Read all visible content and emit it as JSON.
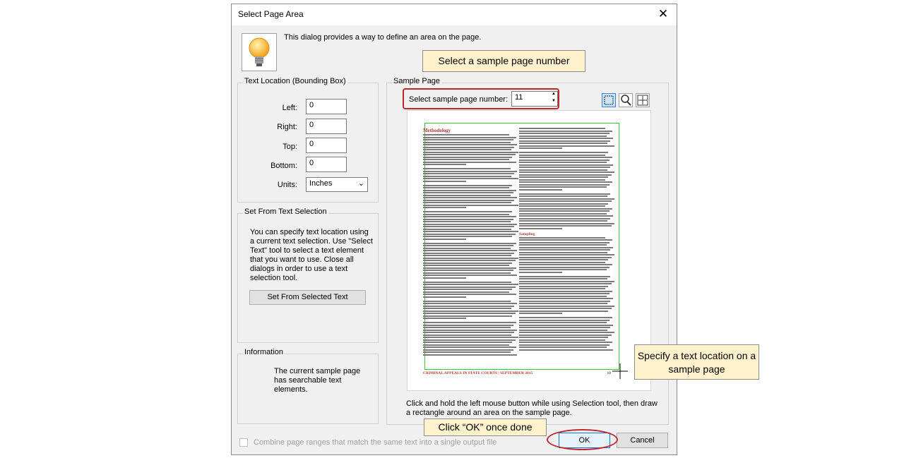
{
  "dialog": {
    "title": "Select Page Area",
    "close_glyph": "✕",
    "intro": "This dialog provides a way to define an area on the page."
  },
  "text_location": {
    "group_label": "Text Location (Bounding Box)",
    "left_label": "Left:",
    "left_value": "0",
    "right_label": "Right:",
    "right_value": "0",
    "top_label": "Top:",
    "top_value": "0",
    "bottom_label": "Bottom:",
    "bottom_value": "0",
    "units_label": "Units:",
    "units_value": "Inches"
  },
  "set_from_text": {
    "group_label": "Set From Text Selection",
    "description": "You can specify text location using a current text selection.  Use \"Select Text\" tool to select a text element that you want to use. Close all dialogs in order to use a text selection tool.",
    "button_label": "Set From Selected Text"
  },
  "information": {
    "group_label": "Information",
    "text": "The current sample page has searchable text elements."
  },
  "sample_page": {
    "group_label": "Sample Page",
    "page_number_label": "Select sample page number:",
    "page_number_value": "11",
    "instruction": "Click and hold the left mouse button while using Selection tool, then draw a rectangle around an area on the sample page.",
    "tools": [
      "selection-tool-icon",
      "zoom-tool-icon",
      "fit-page-icon"
    ]
  },
  "preview_page": {
    "heading": "Methodology",
    "subheading": "Sampling",
    "footer": "CRIMINAL APPEALS IN STATE COURTS | SEPTEMBER 2015",
    "page_number": "10"
  },
  "bottom": {
    "combine_label": "Combine page ranges that match the same text into a single output file",
    "ok_label": "OK",
    "cancel_label": "Cancel"
  },
  "callouts": {
    "sample_page": "Select a sample page number",
    "text_location": "Specify a text location on a sample page",
    "ok": "Click “OK” once done"
  },
  "colors": {
    "annotation_red": "#c0272d",
    "callout_fill": "#fff2cc",
    "selection_green": "#33cc33"
  }
}
